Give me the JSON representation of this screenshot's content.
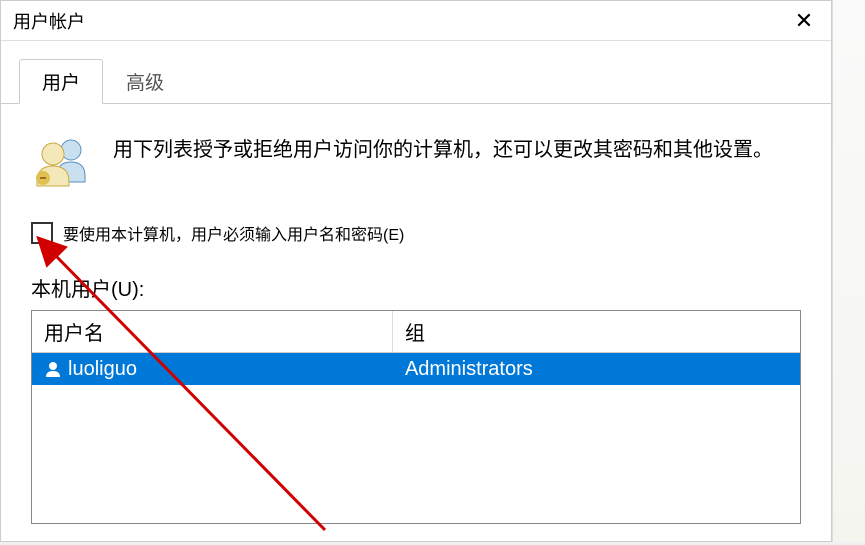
{
  "window": {
    "title": "用户帐户"
  },
  "tabs": {
    "user": "用户",
    "advanced": "高级"
  },
  "description": "用下列表授予或拒绝用户访问你的计算机，还可以更改其密码和其他设置。",
  "checkbox_label": "要使用本计算机，用户必须输入用户名和密码(E)",
  "list_label": "本机用户(U):",
  "table": {
    "col_username": "用户名",
    "col_group": "组",
    "rows": [
      {
        "username": "luoliguo",
        "group": "Administrators"
      }
    ]
  }
}
